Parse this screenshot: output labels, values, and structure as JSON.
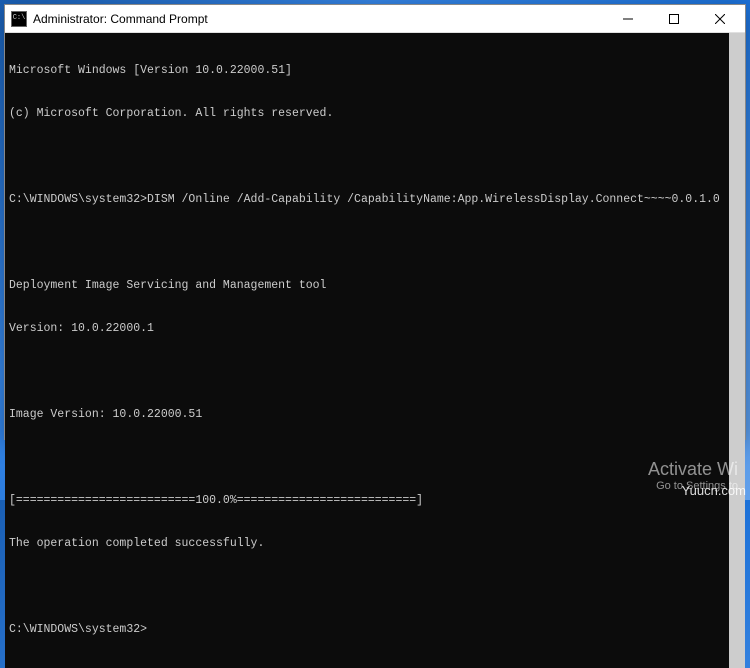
{
  "window": {
    "title": "Administrator: Command Prompt"
  },
  "terminal": {
    "lines": [
      "Microsoft Windows [Version 10.0.22000.51]",
      "(c) Microsoft Corporation. All rights reserved.",
      "",
      "C:\\WINDOWS\\system32>DISM /Online /Add-Capability /CapabilityName:App.WirelessDisplay.Connect~~~~0.0.1.0",
      "",
      "Deployment Image Servicing and Management tool",
      "Version: 10.0.22000.1",
      "",
      "Image Version: 10.0.22000.51",
      "",
      "[==========================100.0%==========================]",
      "The operation completed successfully.",
      "",
      "C:\\WINDOWS\\system32>"
    ]
  },
  "watermark": {
    "title": "Activate Wi",
    "sub": "Go to Settings to"
  },
  "site": "Yuucn.com"
}
